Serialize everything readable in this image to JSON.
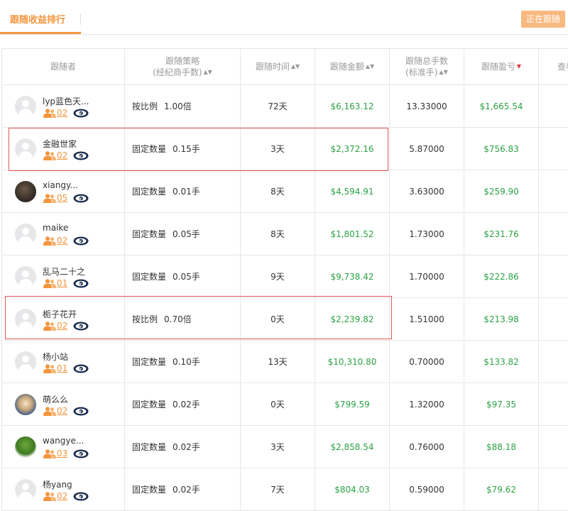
{
  "header": {
    "tab_label": "跟随收益排行",
    "follow_button": "正在跟随"
  },
  "table": {
    "columns": {
      "follower": "跟随者",
      "strategy_line1": "跟随策略",
      "strategy_line2": "(经纪商手数)",
      "time": "跟随时间",
      "amount": "跟随金额",
      "lots_line1": "跟随总手数",
      "lots_line2": "(标准手)",
      "profit": "跟随盈亏",
      "view": "查看"
    },
    "rows": [
      {
        "name": "lyp蓝色天...",
        "count": "02",
        "strategy": "按比例",
        "param": "1.00倍",
        "time": "72天",
        "amount": "$6,163.12",
        "lots": "13.33000",
        "profit": "$1,665.54",
        "avatar": "default"
      },
      {
        "name": "金融世家",
        "count": "02",
        "strategy": "固定数量",
        "param": "0.15手",
        "time": "3天",
        "amount": "$2,372.16",
        "lots": "5.87000",
        "profit": "$756.83",
        "avatar": "default"
      },
      {
        "name": "xiangy...",
        "count": "05",
        "strategy": "固定数量",
        "param": "0.01手",
        "time": "8天",
        "amount": "$4,594.91",
        "lots": "3.63000",
        "profit": "$259.90",
        "avatar": "photo-dark"
      },
      {
        "name": "maike",
        "count": "02",
        "strategy": "固定数量",
        "param": "0.05手",
        "time": "8天",
        "amount": "$1,801.52",
        "lots": "1.73000",
        "profit": "$231.76",
        "avatar": "default"
      },
      {
        "name": "乱马二十之",
        "count": "01",
        "strategy": "固定数量",
        "param": "0.05手",
        "time": "9天",
        "amount": "$9,738.42",
        "lots": "1.70000",
        "profit": "$222.86",
        "avatar": "default"
      },
      {
        "name": "栀子花开",
        "count": "02",
        "strategy": "按比例",
        "param": "0.70倍",
        "time": "0天",
        "amount": "$2,239.82",
        "lots": "1.51000",
        "profit": "$213.98",
        "avatar": "default"
      },
      {
        "name": "杨小站",
        "count": "01",
        "strategy": "固定数量",
        "param": "0.10手",
        "time": "13天",
        "amount": "$10,310.80",
        "lots": "0.70000",
        "profit": "$133.82",
        "avatar": "default"
      },
      {
        "name": "萌么么",
        "count": "02",
        "strategy": "固定数量",
        "param": "0.02手",
        "time": "0天",
        "amount": "$799.59",
        "lots": "1.32000",
        "profit": "$97.35",
        "avatar": "photo-anime"
      },
      {
        "name": "wangye...",
        "count": "03",
        "strategy": "固定数量",
        "param": "0.02手",
        "time": "3天",
        "amount": "$2,858.54",
        "lots": "0.76000",
        "profit": "$88.18",
        "avatar": "photo-tree"
      },
      {
        "name": "杨yang",
        "count": "02",
        "strategy": "固定数量",
        "param": "0.02手",
        "time": "7天",
        "amount": "$804.03",
        "lots": "0.59000",
        "profit": "$79.62",
        "avatar": "default"
      }
    ]
  },
  "colors": {
    "accent_orange": "#f4953e",
    "profit_green": "#2ba245",
    "highlight_red": "#e15858",
    "sort_active_red": "#e4393c"
  },
  "icons": {
    "sort": "sort-updown-icon",
    "sort_active": "sort-down-active-icon",
    "people": "people-group-icon",
    "verified": "vip-eye-badge-icon"
  }
}
